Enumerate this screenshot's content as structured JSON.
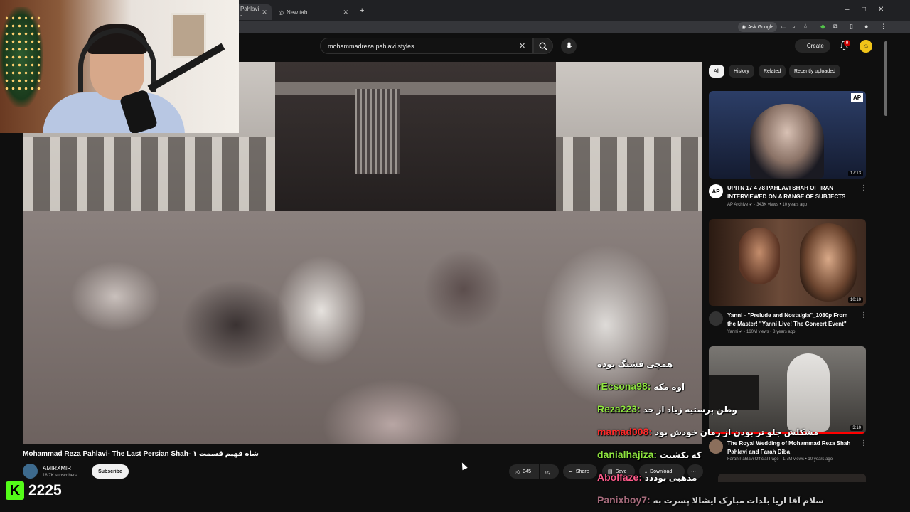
{
  "browser": {
    "tabs": [
      {
        "label": "Pahlavi - "
      },
      {
        "label": "New tab"
      }
    ],
    "new_tab_glyph": "+",
    "ask_google_label": "Ask Google",
    "window_controls": [
      "–",
      "□",
      "✕"
    ]
  },
  "header": {
    "search_value": "mohammadreza pahlavi styles",
    "create_label": "Create",
    "notification_count": "9"
  },
  "video": {
    "title": "Mohammad Reza Pahlavi- The Last Persian Shah- شاه فهیم قسمت ۱",
    "channel_name": "AMIRXMIR",
    "subscribers": "18.7K subscribers",
    "subscribe_label": "Subscribe",
    "like_count": "345",
    "share_label": "Share",
    "save_label": "Save",
    "download_label": "Download",
    "more_label": "···"
  },
  "filters": [
    {
      "label": "All",
      "active": true
    },
    {
      "label": "History"
    },
    {
      "label": "Related"
    },
    {
      "label": "Recently uploaded"
    }
  ],
  "recommended": [
    {
      "title": "UPITN 17 4 78 PAHLAVI SHAH OF IRAN INTERVIEWED ON A RANGE OF SUBJECTS",
      "channel": "AP Archive",
      "meta": "343K views • 10 years ago",
      "duration": "17:13",
      "badge": "AP"
    },
    {
      "title": "Yanni - \"Prelude and Nostalgia\"_1080p From the Master! \"Yanni Live! The Concert Event\"",
      "channel": "Yanni",
      "meta": "160M views • 8 years ago",
      "duration": "10:10"
    },
    {
      "title": "The Royal Wedding of Mohammad Reza Shah Pahlavi and Farah Diba",
      "channel": "Farah Pahlavi Official Page",
      "meta": "1.7M views • 10 years ago",
      "duration": "3:10"
    }
  ],
  "chat": [
    {
      "user": "",
      "message": "همچی قشنگ بوده"
    },
    {
      "user": "rEcsona98:",
      "message": "اوه مکه",
      "color": "green"
    },
    {
      "user": "Reza223:",
      "message": "وطن پرستیه زیاد از حد",
      "color": "green"
    },
    {
      "user": "mamad008:",
      "message": "مشکلش جلو تر بودن از زمان خودش بود",
      "color": "red"
    },
    {
      "user": "danialhajiza:",
      "message": "که نکشتت",
      "color": "green"
    },
    {
      "user": "Abolfaze:",
      "message": "مذهبی بوددد",
      "color": "pink"
    },
    {
      "user": "Panixboy7:",
      "message": "سلام آقا اریا بلدات مبارک ایشالا پسرت به",
      "color": "dim"
    }
  ],
  "stream": {
    "kick_letter": "K",
    "viewer_count": "2225"
  }
}
